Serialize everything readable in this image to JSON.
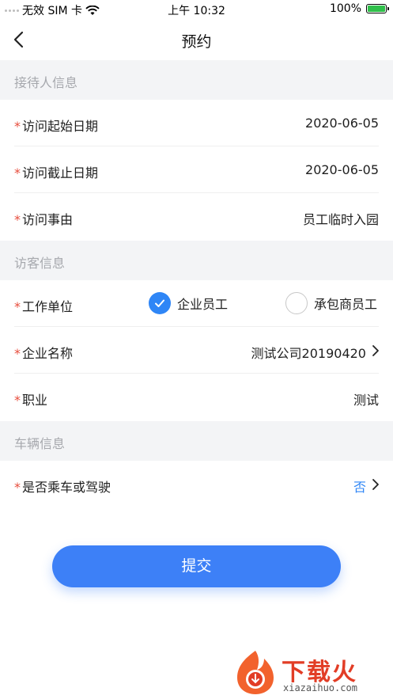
{
  "status_bar": {
    "carrier": "无效 SIM 卡",
    "time": "上午 10:32",
    "battery": "100%"
  },
  "nav": {
    "title": "预约"
  },
  "sections": {
    "host_info": "接待人信息",
    "visitor_info": "访客信息",
    "vehicle_info": "车辆信息"
  },
  "required_mark": "*",
  "rows": {
    "visit_start": {
      "label": "访问起始日期",
      "value": "2020-06-05"
    },
    "visit_end": {
      "label": "访问截止日期",
      "value": "2020-06-05"
    },
    "visit_reason": {
      "label": "访问事由",
      "value": "员工临时入园"
    },
    "work_unit": {
      "label": "工作单位",
      "options": [
        "企业员工",
        "承包商员工"
      ],
      "selected": "企业员工"
    },
    "company_name": {
      "label": "企业名称",
      "value": "测试公司20190420"
    },
    "occupation": {
      "label": "职业",
      "value": "测试"
    },
    "vehicle": {
      "label": "是否乘车或驾驶",
      "value": "否"
    }
  },
  "submit_label": "提交",
  "watermark": {
    "text": "下载火",
    "url": "xiazaihuo.com"
  },
  "colors": {
    "accent": "#2f86f6",
    "button": "#3d80f7",
    "required": "#e74c3c",
    "section_bg": "#f3f4f6"
  }
}
